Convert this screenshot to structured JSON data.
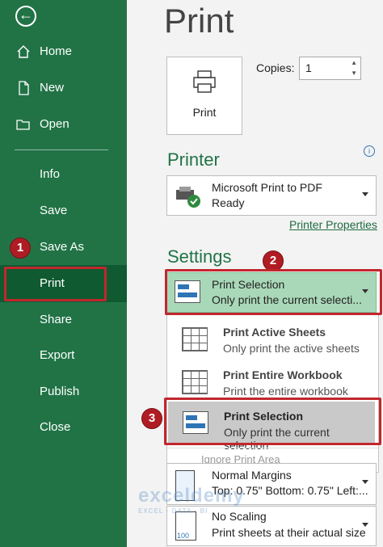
{
  "sidebar": {
    "items": [
      {
        "label": "Home",
        "icon": "home-icon"
      },
      {
        "label": "New",
        "icon": "new-document-icon"
      },
      {
        "label": "Open",
        "icon": "folder-icon"
      },
      {
        "label": "Info"
      },
      {
        "label": "Save"
      },
      {
        "label": "Save As"
      },
      {
        "label": "Print"
      },
      {
        "label": "Share"
      },
      {
        "label": "Export"
      },
      {
        "label": "Publish"
      },
      {
        "label": "Close"
      }
    ],
    "selected": "Print"
  },
  "header": {
    "title": "Print"
  },
  "print_button": {
    "label": "Print"
  },
  "copies": {
    "label": "Copies:",
    "value": "1"
  },
  "printer": {
    "heading": "Printer",
    "name": "Microsoft Print to PDF",
    "status": "Ready",
    "properties_link": "Printer Properties"
  },
  "settings": {
    "heading": "Settings",
    "selected": {
      "title": "Print Selection",
      "subtitle": "Only print the current selecti..."
    },
    "menu": [
      {
        "title": "Print Active Sheets",
        "subtitle": "Only print the active sheets"
      },
      {
        "title": "Print Entire Workbook",
        "subtitle": "Print the entire workbook"
      },
      {
        "title": "Print Selection",
        "subtitle": "Only print the current selection"
      }
    ],
    "ignore_print_area": "Ignore Print Area",
    "margins": {
      "title": "Normal Margins",
      "subtitle": "Top: 0.75\" Bottom: 0.75\" Left:..."
    },
    "scaling": {
      "title": "No Scaling",
      "subtitle": "Print sheets at their actual size",
      "icon_text": "100"
    }
  },
  "annotations": [
    "1",
    "2",
    "3"
  ],
  "watermark": {
    "name": "exceldemy",
    "tagline": "EXCEL · DATA · BI"
  },
  "colors": {
    "accent": "#217346",
    "callout": "#c1272d",
    "selection_fill": "#a9d8b8"
  }
}
